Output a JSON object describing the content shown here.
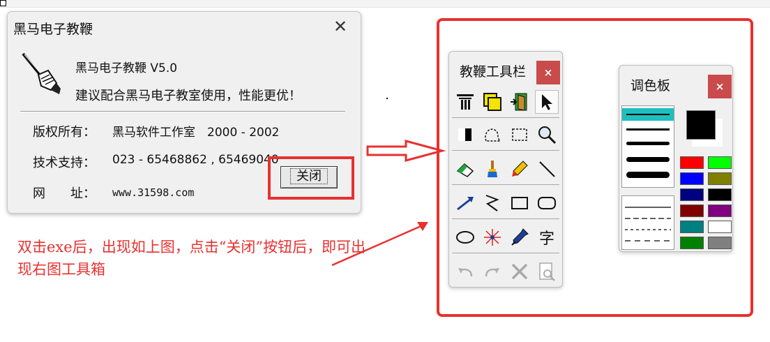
{
  "about_dialog": {
    "title": "黑马电子教鞭",
    "close_x": "✕",
    "product": "黑马电子教鞭 V5.0",
    "slogan": "建议配合黑马电子教室使用，性能更优！",
    "rows": [
      {
        "label": "版权所有：",
        "value": "黑马软件工作室　2000 - 2002"
      },
      {
        "label": "技术支持：",
        "value": "023 - 65468862 , 65469040"
      },
      {
        "label": "网　　址：",
        "value": "www.31598.com"
      }
    ],
    "close_button": "关闭"
  },
  "toolbox": {
    "title": "教鞭工具栏",
    "close_x": "×",
    "tools": [
      [
        "text-style-icon",
        "layers-icon",
        "exit-door-icon",
        "pointer-arrow-icon"
      ],
      [
        "black-white-screen-icon",
        "freeform-select-icon",
        "rect-select-icon",
        "magnifier-icon"
      ],
      [
        "eraser-icon",
        "brush-icon",
        "pencil-icon",
        "line-icon"
      ],
      [
        "arrow-pen-icon",
        "zigzag-icon",
        "rectangle-icon",
        "rounded-rect-icon"
      ],
      [
        "ellipse-icon",
        "spotlight-icon",
        "dropper-icon",
        "text-char-icon"
      ],
      [
        "undo-icon",
        "redo-icon",
        "delete-icon",
        "preview-icon"
      ]
    ],
    "text_tool_char": "字"
  },
  "palette": {
    "title": "调色板",
    "close_x": "×",
    "current_color": "#000000",
    "colors": [
      [
        "#ff0000",
        "#00ff00"
      ],
      [
        "#0000ff",
        "#808000"
      ],
      [
        "#000080",
        "#000000"
      ],
      [
        "#800000",
        "#800080"
      ],
      [
        "#008080",
        "#ffffff"
      ],
      [
        "#008000",
        "#808080"
      ]
    ]
  },
  "annotation": {
    "text": "双击exe后，出现如上图，点击“关闭”按钮后，即可出现右图工具箱",
    "color": "#e8302f"
  }
}
